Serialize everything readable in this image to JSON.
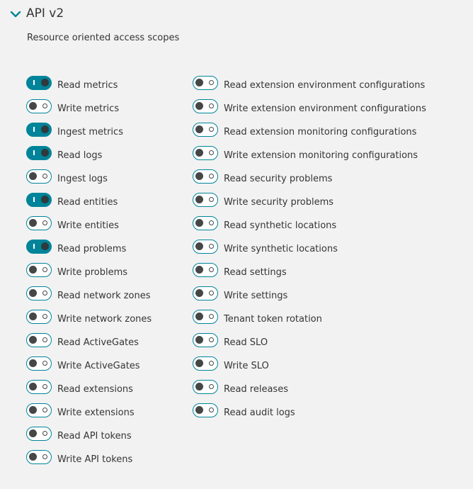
{
  "section": {
    "title": "API v2",
    "subtitle": "Resource oriented access scopes",
    "chevron_icon": "chevron-down-icon",
    "accent": "#00849a"
  },
  "scopes_left": [
    {
      "label": "Read metrics",
      "enabled": true
    },
    {
      "label": "Write metrics",
      "enabled": false
    },
    {
      "label": "Ingest metrics",
      "enabled": true
    },
    {
      "label": "Read logs",
      "enabled": true
    },
    {
      "label": "Ingest logs",
      "enabled": false
    },
    {
      "label": "Read entities",
      "enabled": true
    },
    {
      "label": "Write entities",
      "enabled": false
    },
    {
      "label": "Read problems",
      "enabled": true
    },
    {
      "label": "Write problems",
      "enabled": false
    },
    {
      "label": "Read network zones",
      "enabled": false
    },
    {
      "label": "Write network zones",
      "enabled": false
    },
    {
      "label": "Read ActiveGates",
      "enabled": false
    },
    {
      "label": "Write ActiveGates",
      "enabled": false
    },
    {
      "label": "Read extensions",
      "enabled": false
    },
    {
      "label": "Write extensions",
      "enabled": false
    },
    {
      "label": "Read API tokens",
      "enabled": false
    },
    {
      "label": "Write API tokens",
      "enabled": false
    }
  ],
  "scopes_right": [
    {
      "label": "Read extension environment configurations",
      "enabled": false
    },
    {
      "label": "Write extension environment configurations",
      "enabled": false
    },
    {
      "label": "Read extension monitoring configurations",
      "enabled": false
    },
    {
      "label": "Write extension monitoring configurations",
      "enabled": false
    },
    {
      "label": "Read security problems",
      "enabled": false
    },
    {
      "label": "Write security problems",
      "enabled": false
    },
    {
      "label": "Read synthetic locations",
      "enabled": false
    },
    {
      "label": "Write synthetic locations",
      "enabled": false
    },
    {
      "label": "Read settings",
      "enabled": false
    },
    {
      "label": "Write settings",
      "enabled": false
    },
    {
      "label": "Tenant token rotation",
      "enabled": false
    },
    {
      "label": "Read SLO",
      "enabled": false
    },
    {
      "label": "Write SLO",
      "enabled": false
    },
    {
      "label": "Read releases",
      "enabled": false
    },
    {
      "label": "Read audit logs",
      "enabled": false
    }
  ]
}
